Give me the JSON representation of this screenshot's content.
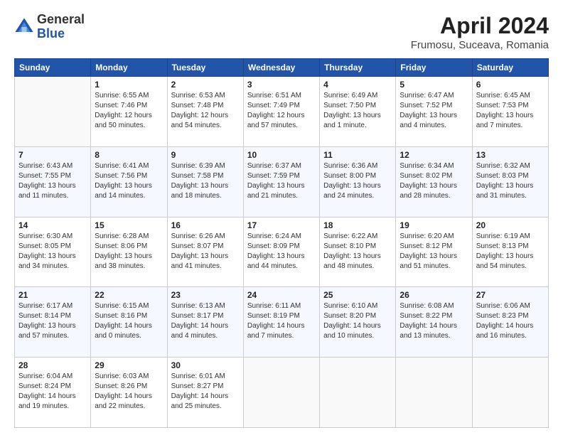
{
  "header": {
    "logo_line1": "General",
    "logo_line2": "Blue",
    "title": "April 2024",
    "subtitle": "Frumosu, Suceava, Romania"
  },
  "days_of_week": [
    "Sunday",
    "Monday",
    "Tuesday",
    "Wednesday",
    "Thursday",
    "Friday",
    "Saturday"
  ],
  "weeks": [
    [
      {
        "day": "",
        "info": ""
      },
      {
        "day": "1",
        "info": "Sunrise: 6:55 AM\nSunset: 7:46 PM\nDaylight: 12 hours\nand 50 minutes."
      },
      {
        "day": "2",
        "info": "Sunrise: 6:53 AM\nSunset: 7:48 PM\nDaylight: 12 hours\nand 54 minutes."
      },
      {
        "day": "3",
        "info": "Sunrise: 6:51 AM\nSunset: 7:49 PM\nDaylight: 12 hours\nand 57 minutes."
      },
      {
        "day": "4",
        "info": "Sunrise: 6:49 AM\nSunset: 7:50 PM\nDaylight: 13 hours\nand 1 minute."
      },
      {
        "day": "5",
        "info": "Sunrise: 6:47 AM\nSunset: 7:52 PM\nDaylight: 13 hours\nand 4 minutes."
      },
      {
        "day": "6",
        "info": "Sunrise: 6:45 AM\nSunset: 7:53 PM\nDaylight: 13 hours\nand 7 minutes."
      }
    ],
    [
      {
        "day": "7",
        "info": "Sunrise: 6:43 AM\nSunset: 7:55 PM\nDaylight: 13 hours\nand 11 minutes."
      },
      {
        "day": "8",
        "info": "Sunrise: 6:41 AM\nSunset: 7:56 PM\nDaylight: 13 hours\nand 14 minutes."
      },
      {
        "day": "9",
        "info": "Sunrise: 6:39 AM\nSunset: 7:58 PM\nDaylight: 13 hours\nand 18 minutes."
      },
      {
        "day": "10",
        "info": "Sunrise: 6:37 AM\nSunset: 7:59 PM\nDaylight: 13 hours\nand 21 minutes."
      },
      {
        "day": "11",
        "info": "Sunrise: 6:36 AM\nSunset: 8:00 PM\nDaylight: 13 hours\nand 24 minutes."
      },
      {
        "day": "12",
        "info": "Sunrise: 6:34 AM\nSunset: 8:02 PM\nDaylight: 13 hours\nand 28 minutes."
      },
      {
        "day": "13",
        "info": "Sunrise: 6:32 AM\nSunset: 8:03 PM\nDaylight: 13 hours\nand 31 minutes."
      }
    ],
    [
      {
        "day": "14",
        "info": "Sunrise: 6:30 AM\nSunset: 8:05 PM\nDaylight: 13 hours\nand 34 minutes."
      },
      {
        "day": "15",
        "info": "Sunrise: 6:28 AM\nSunset: 8:06 PM\nDaylight: 13 hours\nand 38 minutes."
      },
      {
        "day": "16",
        "info": "Sunrise: 6:26 AM\nSunset: 8:07 PM\nDaylight: 13 hours\nand 41 minutes."
      },
      {
        "day": "17",
        "info": "Sunrise: 6:24 AM\nSunset: 8:09 PM\nDaylight: 13 hours\nand 44 minutes."
      },
      {
        "day": "18",
        "info": "Sunrise: 6:22 AM\nSunset: 8:10 PM\nDaylight: 13 hours\nand 48 minutes."
      },
      {
        "day": "19",
        "info": "Sunrise: 6:20 AM\nSunset: 8:12 PM\nDaylight: 13 hours\nand 51 minutes."
      },
      {
        "day": "20",
        "info": "Sunrise: 6:19 AM\nSunset: 8:13 PM\nDaylight: 13 hours\nand 54 minutes."
      }
    ],
    [
      {
        "day": "21",
        "info": "Sunrise: 6:17 AM\nSunset: 8:14 PM\nDaylight: 13 hours\nand 57 minutes."
      },
      {
        "day": "22",
        "info": "Sunrise: 6:15 AM\nSunset: 8:16 PM\nDaylight: 14 hours\nand 0 minutes."
      },
      {
        "day": "23",
        "info": "Sunrise: 6:13 AM\nSunset: 8:17 PM\nDaylight: 14 hours\nand 4 minutes."
      },
      {
        "day": "24",
        "info": "Sunrise: 6:11 AM\nSunset: 8:19 PM\nDaylight: 14 hours\nand 7 minutes."
      },
      {
        "day": "25",
        "info": "Sunrise: 6:10 AM\nSunset: 8:20 PM\nDaylight: 14 hours\nand 10 minutes."
      },
      {
        "day": "26",
        "info": "Sunrise: 6:08 AM\nSunset: 8:22 PM\nDaylight: 14 hours\nand 13 minutes."
      },
      {
        "day": "27",
        "info": "Sunrise: 6:06 AM\nSunset: 8:23 PM\nDaylight: 14 hours\nand 16 minutes."
      }
    ],
    [
      {
        "day": "28",
        "info": "Sunrise: 6:04 AM\nSunset: 8:24 PM\nDaylight: 14 hours\nand 19 minutes."
      },
      {
        "day": "29",
        "info": "Sunrise: 6:03 AM\nSunset: 8:26 PM\nDaylight: 14 hours\nand 22 minutes."
      },
      {
        "day": "30",
        "info": "Sunrise: 6:01 AM\nSunset: 8:27 PM\nDaylight: 14 hours\nand 25 minutes."
      },
      {
        "day": "",
        "info": ""
      },
      {
        "day": "",
        "info": ""
      },
      {
        "day": "",
        "info": ""
      },
      {
        "day": "",
        "info": ""
      }
    ]
  ]
}
